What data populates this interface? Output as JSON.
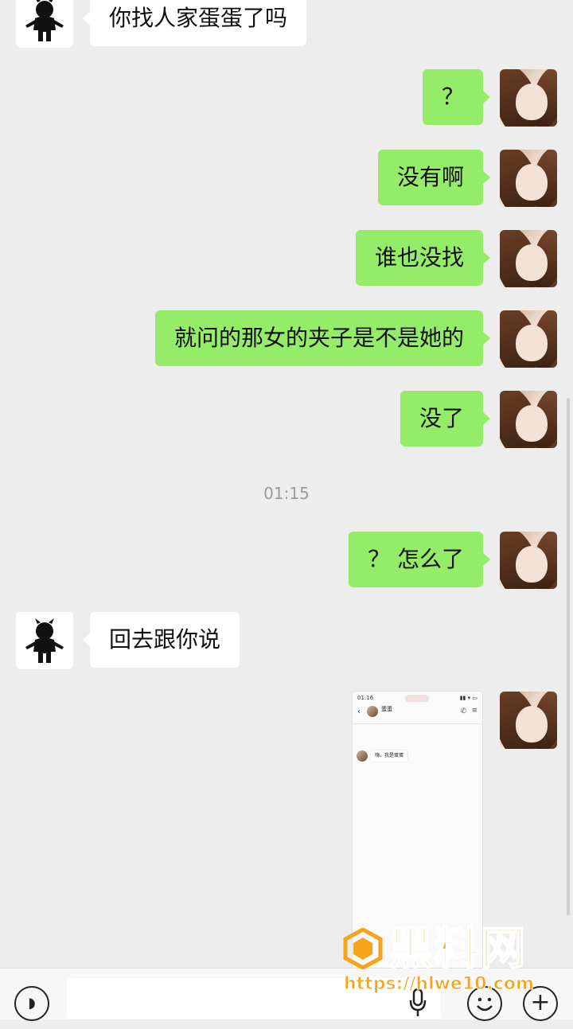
{
  "messages": [
    {
      "side": "left",
      "text": "你找人家蛋蛋了吗"
    },
    {
      "side": "right",
      "text": "？"
    },
    {
      "side": "right",
      "text": "没有啊"
    },
    {
      "side": "right",
      "text": "谁也没找"
    },
    {
      "side": "right",
      "text": "就问的那女的夹子是不是她的"
    },
    {
      "side": "right",
      "text": "没了"
    },
    {
      "side": "right",
      "text": "？ 怎么了"
    },
    {
      "side": "left",
      "text": "回去跟你说"
    }
  ],
  "timestamp": "01:15",
  "screenshot_preview": {
    "status_time": "01:16",
    "status_icons": "▮▮ ▾ ▭",
    "contact_name": "蛋蛋",
    "contact_sub": "",
    "time1": "",
    "time2": "",
    "message": "嗨，我是蛋蛋",
    "time3": "",
    "note": ""
  },
  "watermark": {
    "name": "黑料网",
    "url": "https://hlwe10.com"
  },
  "input": {
    "placeholder": ""
  },
  "colors": {
    "background": "#ededed",
    "bubble_right": "#95ec69",
    "bubble_left": "#ffffff",
    "watermark": "#f5a41b"
  }
}
